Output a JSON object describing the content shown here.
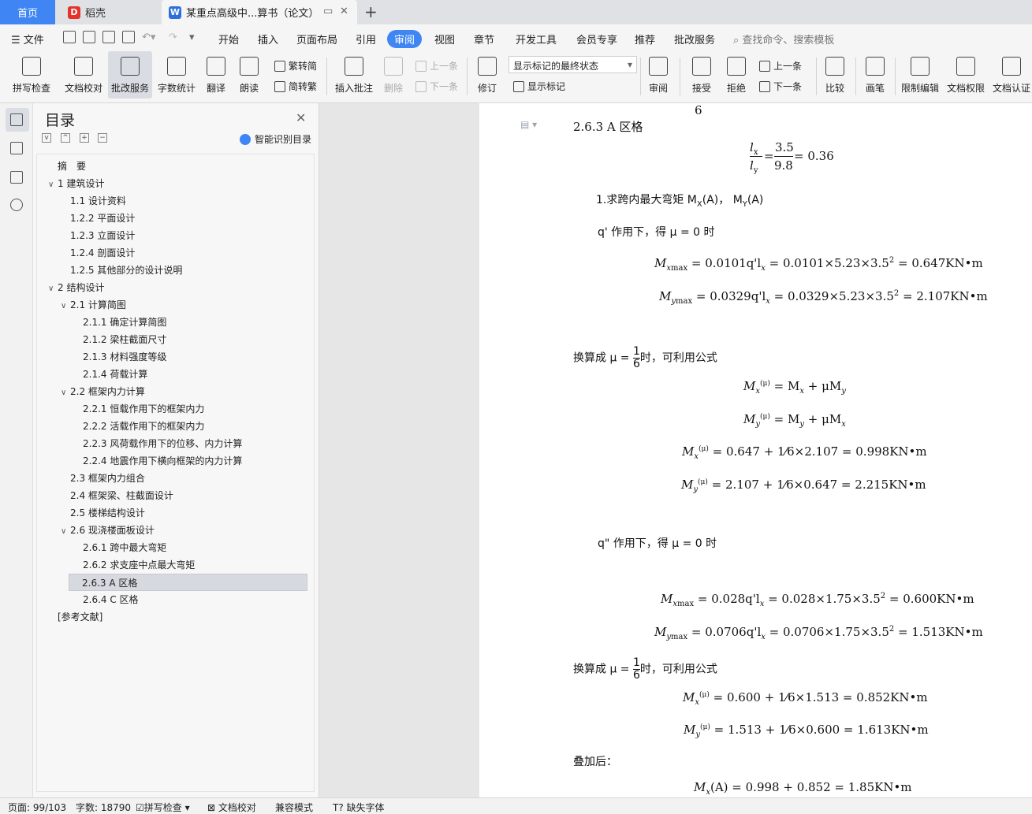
{
  "tabs": {
    "home": "首页",
    "daoke": "稻壳",
    "document": "某重点高级中...算书（论文）"
  },
  "menu": [
    "文件",
    "开始",
    "插入",
    "页面布局",
    "引用",
    "审阅",
    "视图",
    "章节",
    "开发工具",
    "会员专享",
    "推荐",
    "批改服务"
  ],
  "active_menu": "审阅",
  "search_placeholder": "查找命令、搜索模板",
  "ribbon": {
    "spell_check": "拼写检查",
    "doc_proof": "文档校对",
    "correct_service": "批改服务",
    "word_count": "字数统计",
    "translate": "翻译",
    "read_aloud": "朗读",
    "to_traditional": "繁转简",
    "to_simplified": "简转繁",
    "insert_comment": "插入批注",
    "delete": "删除",
    "prev_comment": "上一条",
    "next_comment": "下一条",
    "track_changes": "修订",
    "markup_state": "显示标记的最终状态",
    "show_markup": "显示标记",
    "review": "审阅",
    "accept": "接受",
    "reject": "拒绝",
    "prev_change": "上一条",
    "next_change": "下一条",
    "compare": "比较",
    "pen": "画笔",
    "restrict_edit": "限制编辑",
    "doc_permission": "文档权限",
    "doc_certify": "文档认证"
  },
  "toc": {
    "title": "目录",
    "smart_label": "智能识别目录",
    "items": [
      {
        "text": "摘　要",
        "level": 0,
        "arrow": ""
      },
      {
        "text": "1  建筑设计",
        "level": 0,
        "arrow": "v"
      },
      {
        "text": "1.1  设计资料",
        "level": 1,
        "arrow": ""
      },
      {
        "text": "1.2.2  平面设计",
        "level": 1,
        "arrow": ""
      },
      {
        "text": "1.2.3  立面设计",
        "level": 1,
        "arrow": ""
      },
      {
        "text": "1.2.4  剖面设计",
        "level": 1,
        "arrow": ""
      },
      {
        "text": "1.2.5  其他部分的设计说明",
        "level": 1,
        "arrow": ""
      },
      {
        "text": "2  结构设计",
        "level": 0,
        "arrow": "v"
      },
      {
        "text": "2.1  计算简图",
        "level": 1,
        "arrow": "v"
      },
      {
        "text": "2.1.1  确定计算简图",
        "level": 2,
        "arrow": ""
      },
      {
        "text": "2.1.2  梁柱截面尺寸",
        "level": 2,
        "arrow": ""
      },
      {
        "text": "2.1.3  材料强度等级",
        "level": 2,
        "arrow": ""
      },
      {
        "text": "2.1.4  荷载计算",
        "level": 2,
        "arrow": ""
      },
      {
        "text": "2.2  框架内力计算",
        "level": 1,
        "arrow": "v"
      },
      {
        "text": "2.2.1  恒载作用下的框架内力",
        "level": 2,
        "arrow": ""
      },
      {
        "text": "2.2.2  活载作用下的框架内力",
        "level": 2,
        "arrow": ""
      },
      {
        "text": "2.2.3  风荷载作用下的位移、内力计算",
        "level": 2,
        "arrow": ""
      },
      {
        "text": "2.2.4  地震作用下横向框架的内力计算",
        "level": 2,
        "arrow": ""
      },
      {
        "text": "2.3  框架内力组合",
        "level": 1,
        "arrow": ""
      },
      {
        "text": "2.4  框架梁、柱截面设计",
        "level": 1,
        "arrow": ""
      },
      {
        "text": "2.5  楼梯结构设计",
        "level": 1,
        "arrow": ""
      },
      {
        "text": "2.6  现浇楼面板设计",
        "level": 1,
        "arrow": "v"
      },
      {
        "text": "2.6.1  跨中最大弯矩",
        "level": 2,
        "arrow": ""
      },
      {
        "text": "2.6.2  求支座中点最大弯矩",
        "level": 2,
        "arrow": ""
      },
      {
        "text": "2.6.3 A 区格",
        "level": 2,
        "arrow": "",
        "selected": true
      },
      {
        "text": "2.6.4 C 区格",
        "level": 2,
        "arrow": ""
      },
      {
        "text": "[参考文献]",
        "level": 0,
        "arrow": ""
      }
    ]
  },
  "document": {
    "top_fragment": "6",
    "heading": "2.6.3 A 区格",
    "ratio": {
      "num1": "l",
      "sub1": "x",
      "den1": "l",
      "subd": "y",
      "num2": "3.5",
      "den2": "9.8",
      "result": "= 0.36"
    },
    "step1": "1.求跨内最大弯矩 M",
    "step1_rest": "(A)，  M",
    "step1_end": "(A)",
    "q1_intro": "q' 作用下，得 μ = 0 时",
    "eq_mx1": "= 0.0101q'l",
    "eq_mx1_rest": " = 0.0101×5.23×3.5",
    "eq_mx1_end": " = 0.647KN•m",
    "eq_my1": "= 0.0329q'l",
    "eq_my1_rest": " = 0.0329×5.23×3.5",
    "eq_my1_end": " = 2.107KN•m",
    "convert1_pre": "换算成 μ = ",
    "convert1_post": "时，可利用公式",
    "formula_x": "= M",
    "formula_x_rest": " + μM",
    "formula_y": "= M",
    "formula_y_rest": " + μM",
    "calc_x1": "= 0.647 + ",
    "calc_x1_rest": "×2.107 = 0.998KN•m",
    "calc_y1": "= 2.107 + ",
    "calc_y1_rest": "×0.647 = 2.215KN•m",
    "q2_intro": "q\" 作用下，得 μ = 0 时",
    "eq_mx2": "= 0.028q'l",
    "eq_mx2_rest": " = 0.028×1.75×3.5",
    "eq_mx2_end": " = 0.600KN•m",
    "eq_my2": "= 0.0706q'l",
    "eq_my2_rest": " = 0.0706×1.75×3.5",
    "eq_my2_end": " = 1.513KN•m",
    "convert2_pre": "换算成 μ = ",
    "convert2_post": "时，可利用公式",
    "calc_x2": "= 0.600 + ",
    "calc_x2_rest": "×1.513 = 0.852KN•m",
    "calc_y2": "= 1.513 + ",
    "calc_y2_rest": "×0.600 = 1.613KN•m",
    "sum_label": "叠加后：",
    "sum_eq": "(A) = 0.998 + 0.852 = 1.85KN•m"
  },
  "status": {
    "page": "页面: 99/103",
    "words": "字数: 18790",
    "spell": "拼写检查",
    "proof": "文档校对",
    "compat": "兼容模式",
    "missing_font": "缺失字体"
  }
}
